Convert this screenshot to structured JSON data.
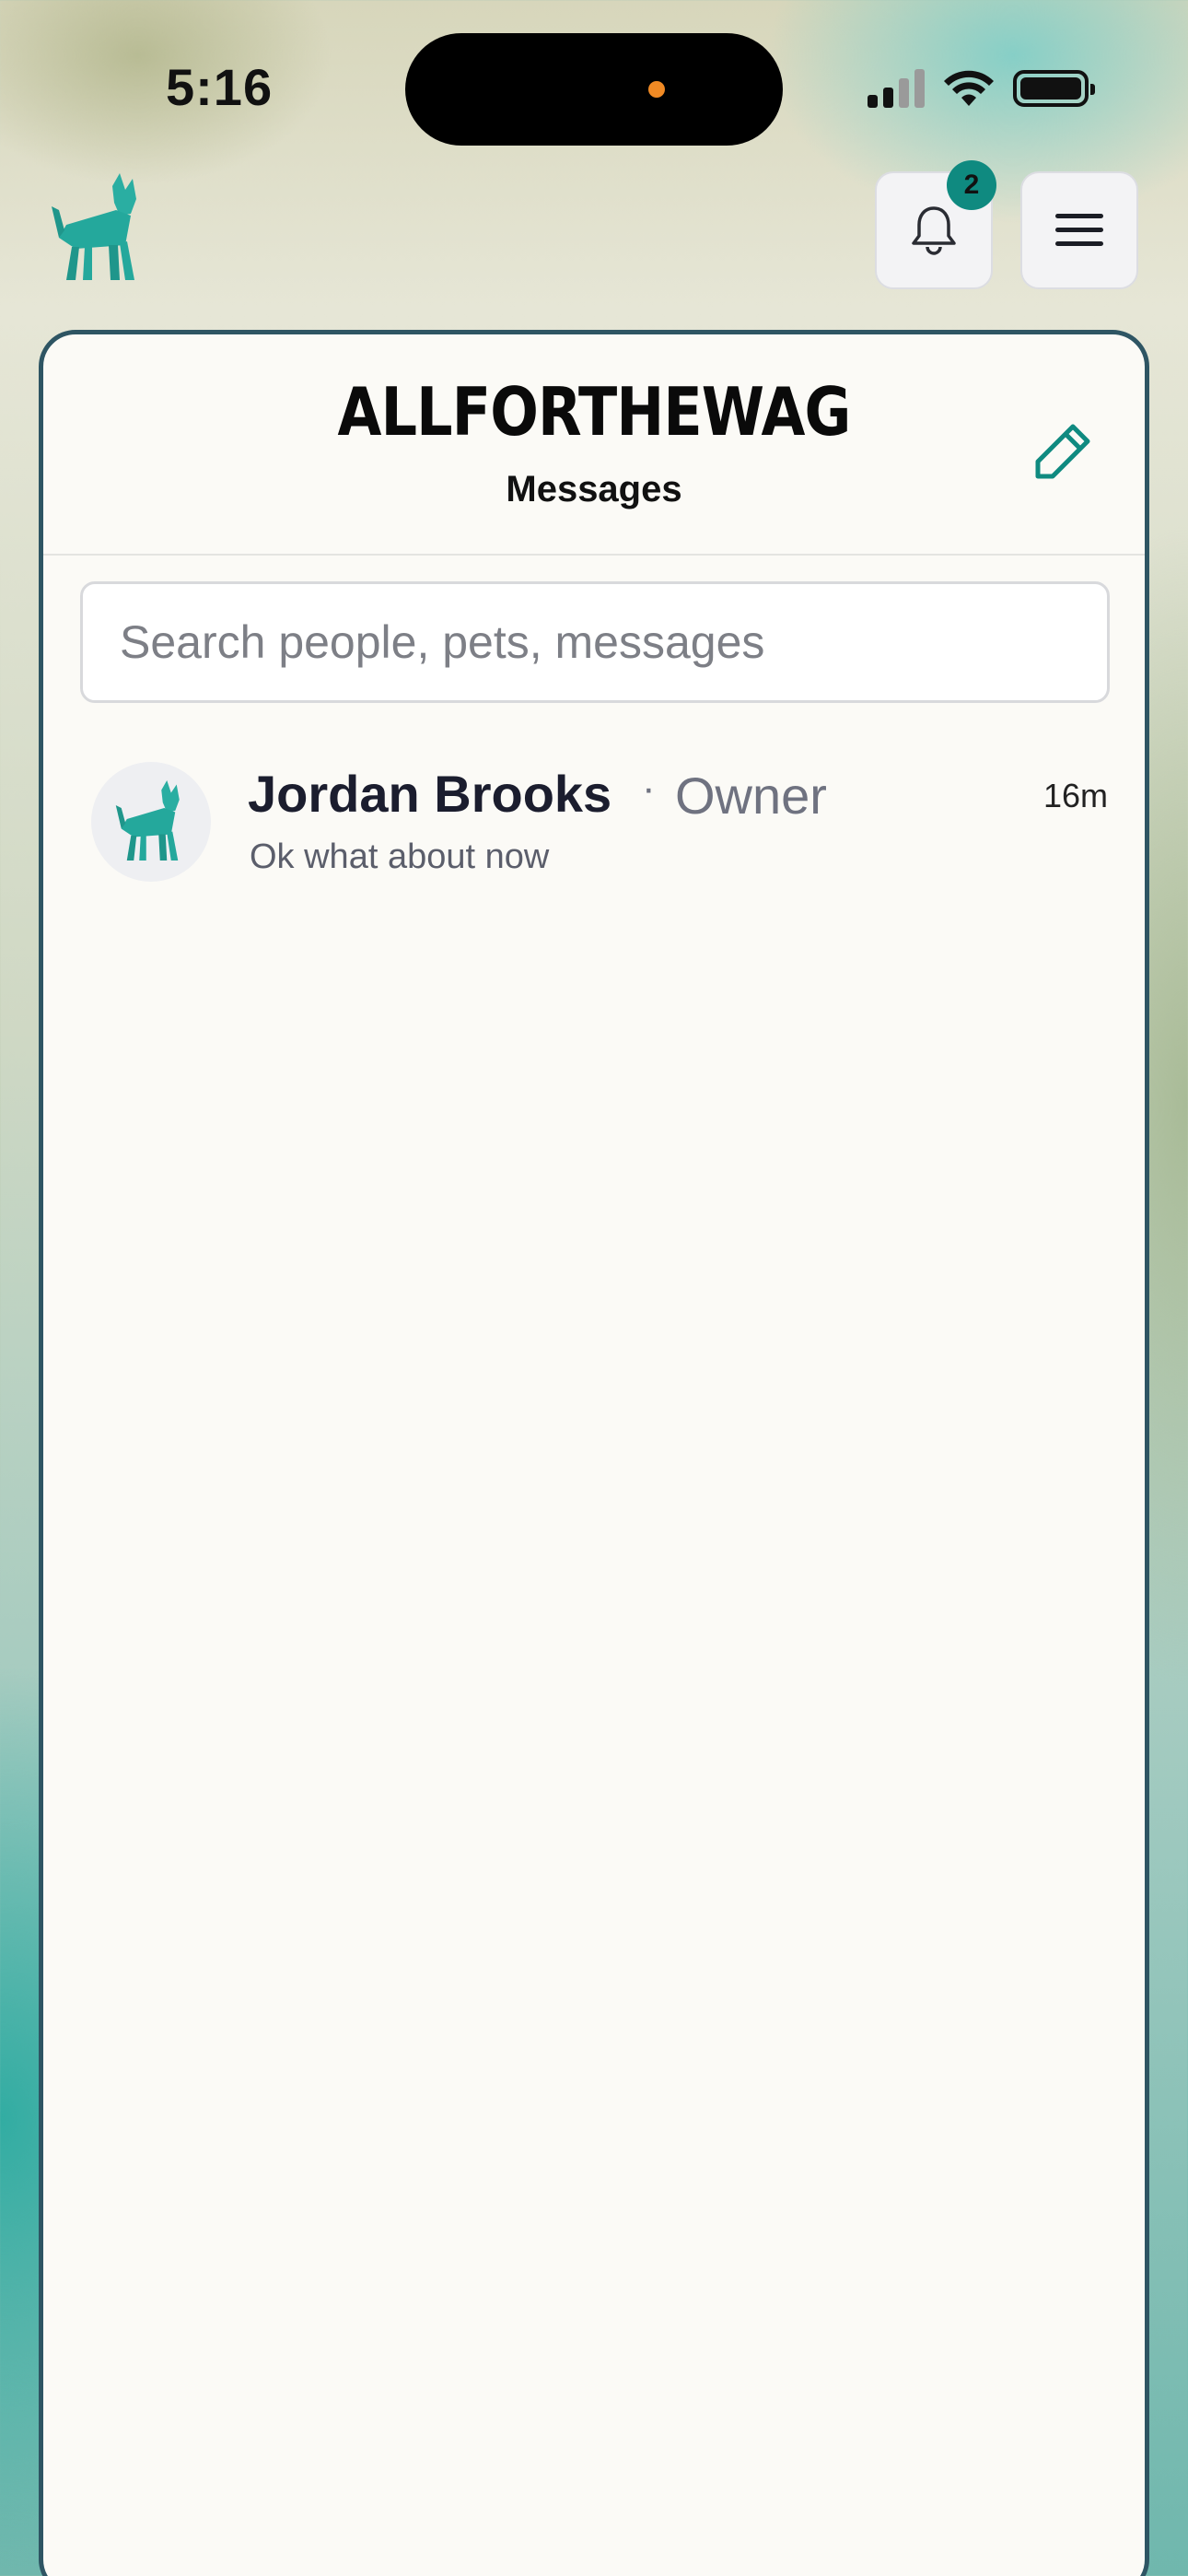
{
  "status_bar": {
    "time": "5:16"
  },
  "header": {
    "logo_icon": "dog-logo-icon",
    "notifications": {
      "icon": "bell-icon",
      "count": "2"
    },
    "menu_icon": "hamburger-menu-icon"
  },
  "card": {
    "brand": "ALLFORTHEWAG",
    "title": "Messages",
    "compose_icon": "pencil-icon",
    "search": {
      "placeholder": "Search people, pets, messages",
      "value": ""
    },
    "conversations": [
      {
        "name": "Jordan Brooks",
        "separator": "·",
        "role": "Owner",
        "time": "16m",
        "preview": "Ok what about now",
        "avatar_icon": "dog-avatar-icon"
      }
    ]
  },
  "colors": {
    "accent": "#0f8a80",
    "dog_teal": "#24a89c",
    "card_border": "#2e5563",
    "card_background": "#fbfaf6"
  }
}
